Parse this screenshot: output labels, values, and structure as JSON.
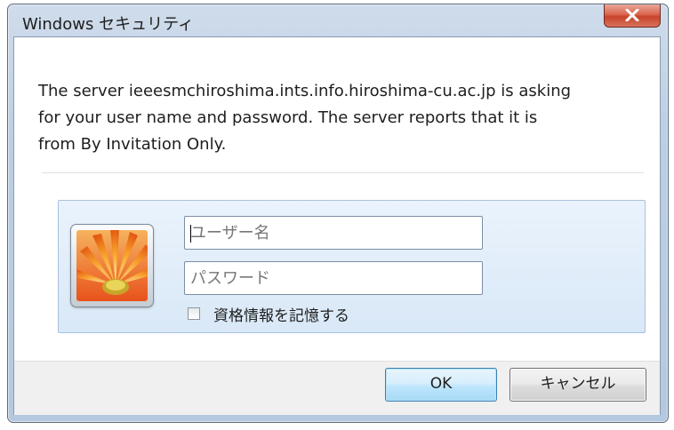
{
  "window": {
    "title": "Windows セキュリティ"
  },
  "message": {
    "line1": "The server ieeesmchiroshima.ints.info.hiroshima-cu.ac.jp is asking",
    "line2": "for your user name and password. The server reports that it is",
    "line3": "from By Invitation Only."
  },
  "credentials": {
    "avatar_icon": "user-tile-flower-icon",
    "username": {
      "value": "",
      "placeholder": "ユーザー名"
    },
    "password": {
      "value": "",
      "placeholder": "パスワード"
    },
    "remember": {
      "label": "資格情報を記憶する",
      "checked": false
    }
  },
  "buttons": {
    "ok_label": "OK",
    "cancel_label": "キャンセル"
  },
  "colors": {
    "close_button": "#c8442b",
    "ok_button_border": "#3c7fb1",
    "panel_background": "#d9e8f7"
  }
}
